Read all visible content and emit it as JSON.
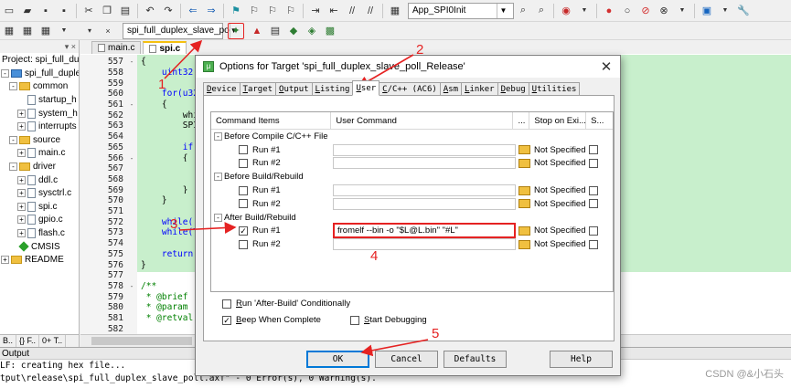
{
  "toolbar": {
    "target_select": "App_SPI0Init",
    "project_select": "spi_full_duplex_slave_po"
  },
  "project": {
    "title": "Project: spi_full_duplex",
    "root": "spi_full_duplex_sl",
    "tree": [
      {
        "kind": "folder",
        "label": "common",
        "level": 1,
        "exp": "-"
      },
      {
        "kind": "file",
        "label": "startup_h",
        "level": 2,
        "exp": ""
      },
      {
        "kind": "file",
        "label": "system_h",
        "level": 2,
        "exp": "+"
      },
      {
        "kind": "file",
        "label": "interrupts",
        "level": 2,
        "exp": "+"
      },
      {
        "kind": "folder",
        "label": "source",
        "level": 1,
        "exp": "-"
      },
      {
        "kind": "file",
        "label": "main.c",
        "level": 2,
        "exp": "+"
      },
      {
        "kind": "folder",
        "label": "driver",
        "level": 1,
        "exp": "-"
      },
      {
        "kind": "file",
        "label": "ddl.c",
        "level": 2,
        "exp": "+"
      },
      {
        "kind": "file",
        "label": "sysctrl.c",
        "level": 2,
        "exp": "+"
      },
      {
        "kind": "file",
        "label": "spi.c",
        "level": 2,
        "exp": "+"
      },
      {
        "kind": "file",
        "label": "gpio.c",
        "level": 2,
        "exp": "+"
      },
      {
        "kind": "file",
        "label": "flash.c",
        "level": 2,
        "exp": "+"
      },
      {
        "kind": "gem",
        "label": "CMSIS",
        "level": 1,
        "exp": ""
      },
      {
        "kind": "folder",
        "label": "README",
        "level": 0,
        "exp": "+"
      }
    ],
    "bottom_tabs": [
      "B..",
      "{} F..",
      "0+ T.."
    ]
  },
  "editor": {
    "tabs": [
      {
        "label": "main.c",
        "active": false
      },
      {
        "label": "spi.c",
        "active": true
      }
    ],
    "lines": [
      {
        "no": "557",
        "fold": "-",
        "text": "{",
        "hl": true
      },
      {
        "no": "558",
        "fold": "",
        "text": "    uint32_",
        "hl": true
      },
      {
        "no": "559",
        "fold": "",
        "text": "",
        "hl": true
      },
      {
        "no": "560",
        "fold": "",
        "text": "    for(u32",
        "hl": true
      },
      {
        "no": "561",
        "fold": "-",
        "text": "    {",
        "hl": true
      },
      {
        "no": "562",
        "fold": "",
        "text": "        whi",
        "hl": true
      },
      {
        "no": "563",
        "fold": "",
        "text": "        SPI",
        "hl": true
      },
      {
        "no": "564",
        "fold": "",
        "text": "",
        "hl": true
      },
      {
        "no": "565",
        "fold": "",
        "text": "        if(",
        "hl": true
      },
      {
        "no": "566",
        "fold": "-",
        "text": "        {",
        "hl": true
      },
      {
        "no": "567",
        "fold": "",
        "text": "",
        "hl": true
      },
      {
        "no": "568",
        "fold": "",
        "text": "",
        "hl": true
      },
      {
        "no": "569",
        "fold": "",
        "text": "        }",
        "hl": true
      },
      {
        "no": "570",
        "fold": "",
        "text": "    }",
        "hl": true
      },
      {
        "no": "571",
        "fold": "",
        "text": "",
        "hl": true
      },
      {
        "no": "572",
        "fold": "",
        "text": "    while(",
        "hl": true
      },
      {
        "no": "573",
        "fold": "",
        "text": "    while(T",
        "hl": true
      },
      {
        "no": "574",
        "fold": "",
        "text": "",
        "hl": true
      },
      {
        "no": "575",
        "fold": "",
        "text": "    return ",
        "hl": true
      },
      {
        "no": "576",
        "fold": "",
        "text": "}",
        "hl": true
      },
      {
        "no": "577",
        "fold": "",
        "text": "",
        "hl": false
      },
      {
        "no": "578",
        "fold": "-",
        "text": "/**",
        "hl": false
      },
      {
        "no": "579",
        "fold": "",
        "text": " * @brief",
        "hl": false
      },
      {
        "no": "580",
        "fold": "",
        "text": " * @param",
        "hl": false
      },
      {
        "no": "581",
        "fold": "",
        "text": " * @retval",
        "hl": false
      },
      {
        "no": "582",
        "fold": "",
        "text": "",
        "hl": false
      }
    ]
  },
  "output": {
    "title": "Output",
    "lines": [
      "LF: creating hex file...",
      "tput\\release\\spi_full_duplex_slave_poll.axf\" - 0 Error(s), 0 Warning(s)."
    ]
  },
  "watermark": "CSDN @&小石头",
  "dialog": {
    "title": "Options for Target 'spi_full_duplex_slave_poll_Release'",
    "tabs": [
      "Device",
      "Target",
      "Output",
      "Listing",
      "User",
      "C/C++ (AC6)",
      "Asm",
      "Linker",
      "Debug",
      "Utilities"
    ],
    "active_tab": "User",
    "columns": [
      "Command Items",
      "User Command",
      "...",
      "Stop on Exi...",
      "S..."
    ],
    "rows": [
      {
        "type": "group",
        "label": "Before Compile C/C++ File",
        "exp": "-"
      },
      {
        "type": "item",
        "label": "Run #1",
        "checked": false,
        "command": "",
        "stop": "Not Specified"
      },
      {
        "type": "item",
        "label": "Run #2",
        "checked": false,
        "command": "",
        "stop": "Not Specified"
      },
      {
        "type": "group",
        "label": "Before Build/Rebuild",
        "exp": "-"
      },
      {
        "type": "item",
        "label": "Run #1",
        "checked": false,
        "command": "",
        "stop": "Not Specified"
      },
      {
        "type": "item",
        "label": "Run #2",
        "checked": false,
        "command": "",
        "stop": "Not Specified"
      },
      {
        "type": "group",
        "label": "After Build/Rebuild",
        "exp": "-"
      },
      {
        "type": "item",
        "label": "Run #1",
        "checked": true,
        "command": "fromelf --bin -o \"$L@L.bin\" \"#L\"",
        "stop": "Not Specified",
        "highlight": true
      },
      {
        "type": "item",
        "label": "Run #2",
        "checked": false,
        "command": "",
        "stop": "Not Specified"
      }
    ],
    "options": [
      {
        "label": "Run 'After-Build' Conditionally",
        "checked": false
      },
      {
        "label": "Beep When Complete",
        "checked": true
      },
      {
        "label": "Start Debugging",
        "checked": false
      }
    ],
    "buttons": {
      "ok": "OK",
      "cancel": "Cancel",
      "defaults": "Defaults",
      "help": "Help"
    }
  },
  "annotations": [
    "1",
    "2",
    "3",
    "4",
    "5"
  ],
  "colors": {
    "annotation": "#e52222",
    "highlight_code": "#c8efcc",
    "selected_border": "#0078d7"
  }
}
